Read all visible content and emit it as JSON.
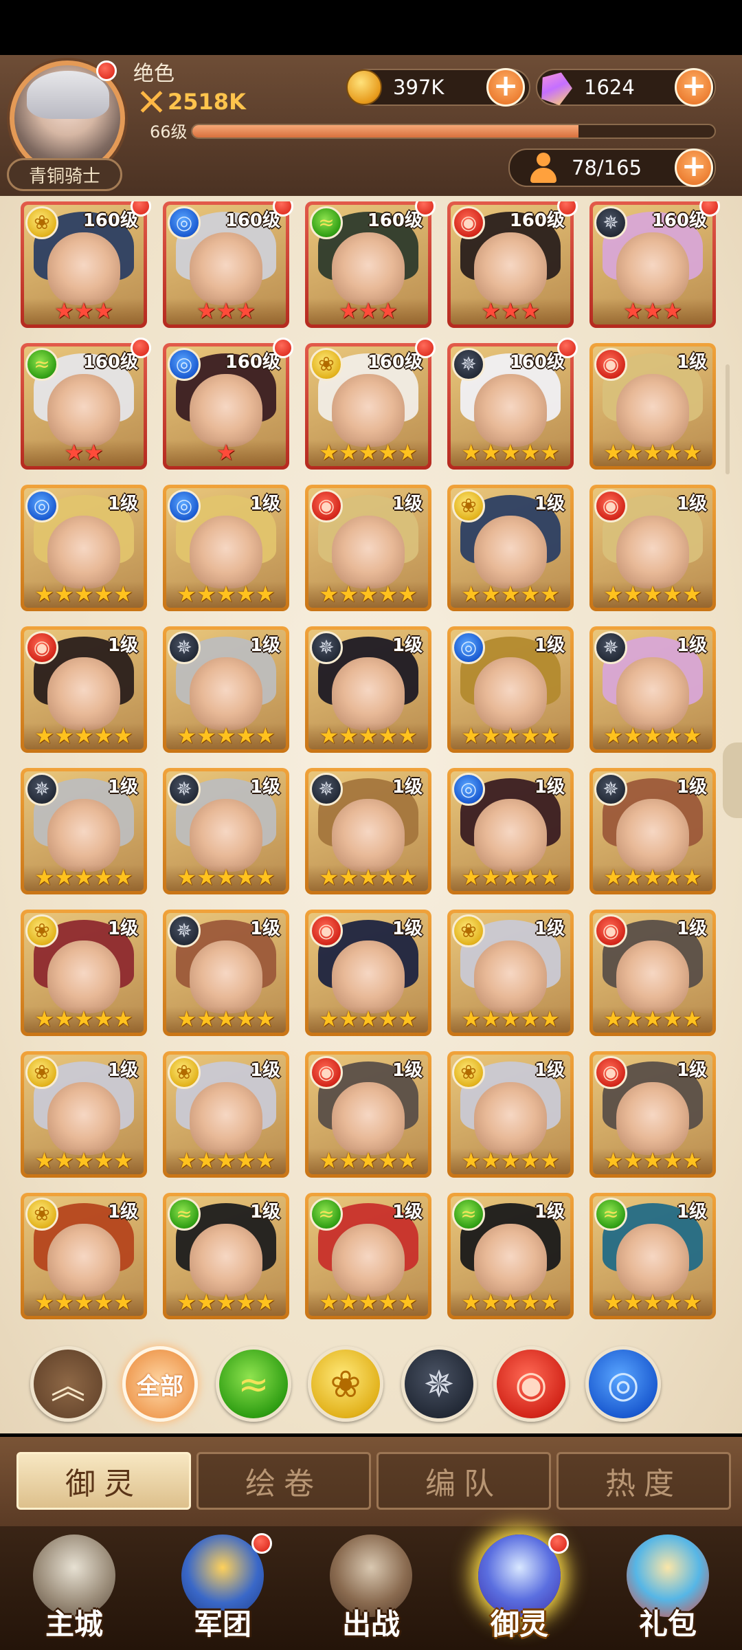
{
  "player": {
    "name": "绝色",
    "power": "2518K",
    "level": "66级",
    "level_progress": 0.74,
    "rank": "青铜骑士"
  },
  "resources": {
    "gold": "397K",
    "gems": "1624",
    "roster": "78/165"
  },
  "icons": {
    "gold": "gold-coin-icon",
    "gems": "gem-icon",
    "roster": "person-icon",
    "add": "plus-icon",
    "power": "crossed-swords-icon"
  },
  "heroes": [
    {
      "level": "160级",
      "faction": "gold",
      "stars": 3,
      "star_color": "red",
      "dot": true,
      "hair": "#2c3f63"
    },
    {
      "level": "160级",
      "faction": "blue",
      "stars": 3,
      "star_color": "red",
      "dot": true,
      "hair": "#cfd0d6"
    },
    {
      "level": "160级",
      "faction": "green",
      "stars": 3,
      "star_color": "red",
      "dot": true,
      "hair": "#2e3b2c"
    },
    {
      "level": "160级",
      "faction": "red",
      "stars": 3,
      "star_color": "red",
      "dot": true,
      "hair": "#2a201c"
    },
    {
      "level": "160级",
      "faction": "dark",
      "stars": 3,
      "star_color": "red",
      "dot": true,
      "hair": "#d8a7d6"
    },
    {
      "level": "160级",
      "faction": "green",
      "stars": 2,
      "star_color": "red",
      "dot": true,
      "hair": "#e5e5e8"
    },
    {
      "level": "160级",
      "faction": "blue",
      "stars": 1,
      "star_color": "red",
      "dot": true,
      "hair": "#3a1e22"
    },
    {
      "level": "160级",
      "faction": "gold",
      "stars": 5,
      "star_color": "gold",
      "dot": true,
      "hair": "#f1ede6"
    },
    {
      "level": "160级",
      "faction": "dark",
      "stars": 5,
      "star_color": "gold",
      "dot": true,
      "hair": "#f0f0f4"
    },
    {
      "level": "1级",
      "faction": "red",
      "stars": 5,
      "star_color": "gold",
      "dot": false,
      "hair": "#d9c07a"
    },
    {
      "level": "1级",
      "faction": "blue",
      "stars": 5,
      "star_color": "gold",
      "dot": false,
      "hair": "#e1c46d"
    },
    {
      "level": "1级",
      "faction": "blue",
      "stars": 5,
      "star_color": "gold",
      "dot": false,
      "hair": "#e1c46d"
    },
    {
      "level": "1级",
      "faction": "red",
      "stars": 5,
      "star_color": "gold",
      "dot": false,
      "hair": "#d9c07a"
    },
    {
      "level": "1级",
      "faction": "gold",
      "stars": 5,
      "star_color": "gold",
      "dot": false,
      "hair": "#2c3f63"
    },
    {
      "level": "1级",
      "faction": "red",
      "stars": 5,
      "star_color": "gold",
      "dot": false,
      "hair": "#d9c07a"
    },
    {
      "level": "1级",
      "faction": "red",
      "stars": 5,
      "star_color": "gold",
      "dot": false,
      "hair": "#2a1f1b"
    },
    {
      "level": "1级",
      "faction": "dark",
      "stars": 5,
      "star_color": "gold",
      "dot": false,
      "hair": "#bdbdbd"
    },
    {
      "level": "1级",
      "faction": "dark",
      "stars": 5,
      "star_color": "gold",
      "dot": false,
      "hair": "#1d1a24"
    },
    {
      "level": "1级",
      "faction": "blue",
      "stars": 5,
      "star_color": "gold",
      "dot": false,
      "hair": "#b38a2e"
    },
    {
      "level": "1级",
      "faction": "dark",
      "stars": 5,
      "star_color": "gold",
      "dot": false,
      "hair": "#d8a7d6"
    },
    {
      "level": "1级",
      "faction": "dark",
      "stars": 5,
      "star_color": "gold",
      "dot": false,
      "hair": "#bdbdbd"
    },
    {
      "level": "1级",
      "faction": "dark",
      "stars": 5,
      "star_color": "gold",
      "dot": false,
      "hair": "#bdbdbd"
    },
    {
      "level": "1级",
      "faction": "dark",
      "stars": 5,
      "star_color": "gold",
      "dot": false,
      "hair": "#a4763d"
    },
    {
      "level": "1级",
      "faction": "blue",
      "stars": 5,
      "star_color": "gold",
      "dot": false,
      "hair": "#3a1e22"
    },
    {
      "level": "1级",
      "faction": "dark",
      "stars": 5,
      "star_color": "gold",
      "dot": false,
      "hair": "#9c5a3a"
    },
    {
      "level": "1级",
      "faction": "gold",
      "stars": 5,
      "star_color": "gold",
      "dot": false,
      "hair": "#8e2a2f"
    },
    {
      "level": "1级",
      "faction": "dark",
      "stars": 5,
      "star_color": "gold",
      "dot": false,
      "hair": "#9c5a3a"
    },
    {
      "level": "1级",
      "faction": "red",
      "stars": 5,
      "star_color": "gold",
      "dot": false,
      "hair": "#1d2440"
    },
    {
      "level": "1级",
      "faction": "gold",
      "stars": 5,
      "star_color": "gold",
      "dot": false,
      "hair": "#c9c9d4"
    },
    {
      "level": "1级",
      "faction": "red",
      "stars": 5,
      "star_color": "gold",
      "dot": false,
      "hair": "#5a4f48"
    },
    {
      "level": "1级",
      "faction": "gold",
      "stars": 5,
      "star_color": "gold",
      "dot": false,
      "hair": "#c9c9d4"
    },
    {
      "level": "1级",
      "faction": "gold",
      "stars": 5,
      "star_color": "gold",
      "dot": false,
      "hair": "#c9c9d4"
    },
    {
      "level": "1级",
      "faction": "red",
      "stars": 5,
      "star_color": "gold",
      "dot": false,
      "hair": "#5a4f48"
    },
    {
      "level": "1级",
      "faction": "gold",
      "stars": 5,
      "star_color": "gold",
      "dot": false,
      "hair": "#c9c9d4"
    },
    {
      "level": "1级",
      "faction": "red",
      "stars": 5,
      "star_color": "gold",
      "dot": false,
      "hair": "#5a4f48"
    },
    {
      "level": "1级",
      "faction": "gold",
      "stars": 5,
      "star_color": "gold",
      "dot": false,
      "hair": "#b5461e"
    },
    {
      "level": "1级",
      "faction": "green",
      "stars": 5,
      "star_color": "gold",
      "dot": false,
      "hair": "#1d1d1d"
    },
    {
      "level": "1级",
      "faction": "green",
      "stars": 5,
      "star_color": "gold",
      "dot": false,
      "hair": "#c8302b"
    },
    {
      "level": "1级",
      "faction": "green",
      "stars": 5,
      "star_color": "gold",
      "dot": false,
      "hair": "#1a1a1a"
    },
    {
      "level": "1级",
      "faction": "green",
      "stars": 5,
      "star_color": "gold",
      "dot": false,
      "hair": "#236b86"
    }
  ],
  "filters": [
    {
      "id": "collapse",
      "label": "︽",
      "icon": "collapse-up-icon"
    },
    {
      "id": "all",
      "label": "全部",
      "icon": "all-icon"
    },
    {
      "id": "green",
      "label": "",
      "icon": "green-faction-icon"
    },
    {
      "id": "gold",
      "label": "",
      "icon": "gold-faction-icon"
    },
    {
      "id": "dark",
      "label": "",
      "icon": "dark-faction-icon"
    },
    {
      "id": "red",
      "label": "",
      "icon": "red-faction-icon"
    },
    {
      "id": "blue",
      "label": "",
      "icon": "blue-faction-icon"
    }
  ],
  "tabs": [
    {
      "label": "御灵",
      "active": true
    },
    {
      "label": "绘卷",
      "active": false
    },
    {
      "label": "编队",
      "active": false
    },
    {
      "label": "热度",
      "active": false
    }
  ],
  "nav": [
    {
      "label": "主城",
      "active": false,
      "dot": false,
      "icon": "castle-icon"
    },
    {
      "label": "军团",
      "active": false,
      "dot": true,
      "icon": "legion-fist-icon"
    },
    {
      "label": "出战",
      "active": false,
      "dot": false,
      "icon": "battle-gate-icon"
    },
    {
      "label": "御灵",
      "active": true,
      "dot": true,
      "icon": "crystal-icon"
    },
    {
      "label": "礼包",
      "active": false,
      "dot": false,
      "icon": "gift-shop-icon"
    }
  ],
  "colors": {
    "accent": "#f09f58",
    "panel": "#5b3b25",
    "star": "#ffc21e",
    "star_red": "#ff4b3a"
  }
}
